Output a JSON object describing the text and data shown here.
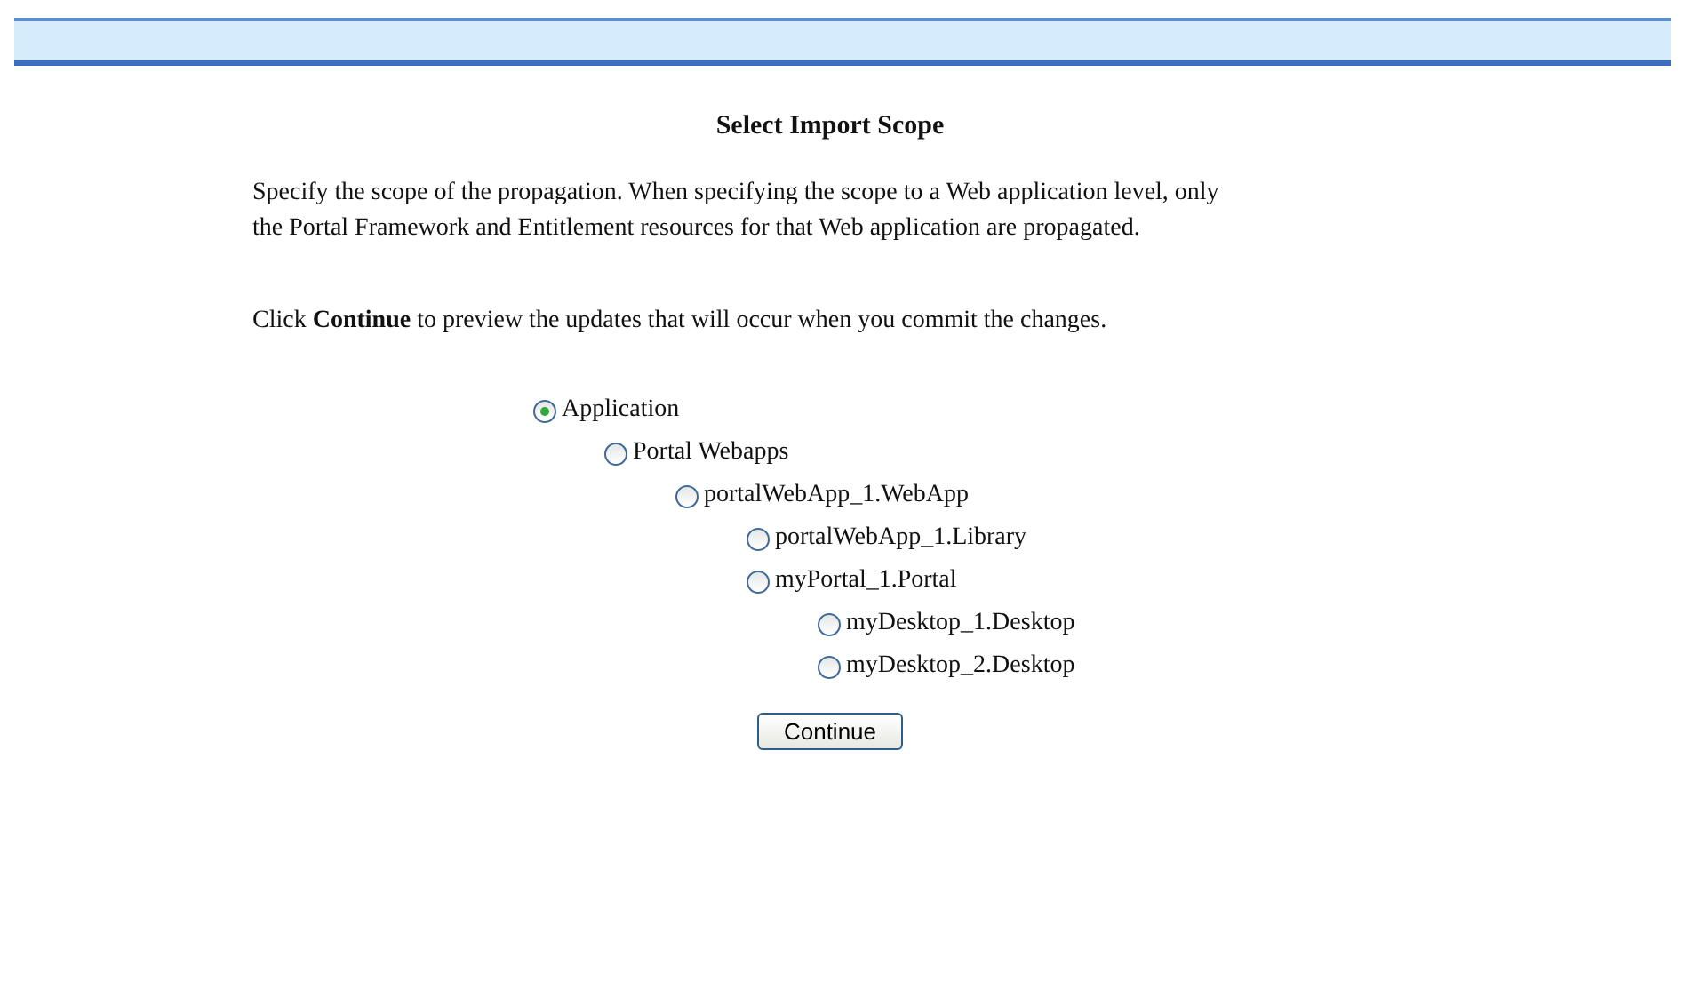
{
  "title": "Select Import Scope",
  "description": "Specify the scope of the propagation. When specifying the scope to a Web application level, only the Portal Framework and Entitlement resources for that Web application are propagated.",
  "instruction": "Click **Continue** to preview the updates that will occur when you commit the changes.",
  "scope_tree": [
    {
      "label": "Application",
      "selected": true,
      "children": [
        {
          "label": "Portal Webapps",
          "selected": false,
          "children": [
            {
              "label": "portalWebApp_1.WebApp",
              "selected": false,
              "children": [
                {
                  "label": "portalWebApp_1.Library",
                  "selected": false
                },
                {
                  "label": "myPortal_1.Portal",
                  "selected": false,
                  "children": [
                    {
                      "label": "myDesktop_1.Desktop",
                      "selected": false
                    },
                    {
                      "label": "myDesktop_2.Desktop",
                      "selected": false
                    }
                  ]
                }
              ]
            }
          ]
        }
      ]
    }
  ],
  "buttons": [
    "Continue"
  ]
}
